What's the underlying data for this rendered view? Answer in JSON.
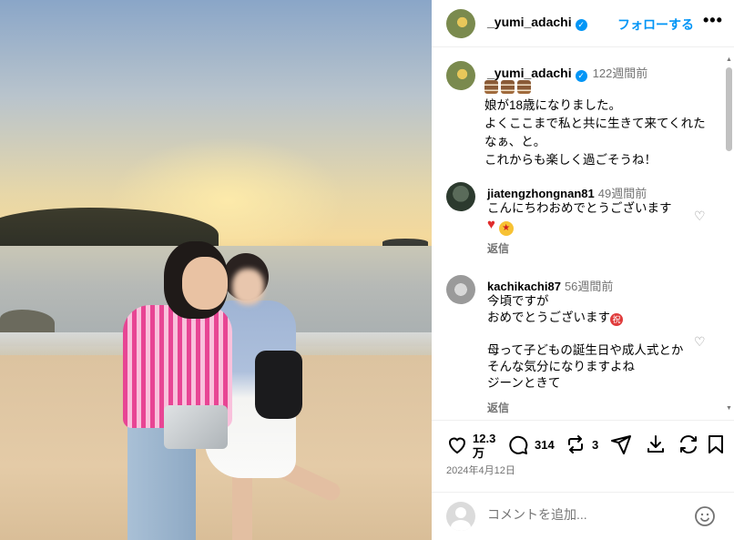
{
  "post": {
    "username": "_yumi_adachi",
    "follow_label": "フォローする",
    "more_label": "•••"
  },
  "caption": {
    "username": "_yumi_adachi",
    "time": "122週間前",
    "text": "娘が18歳になりました。\nよくここまで私と共に生きて来てくれたなぁ、と。\nこれからも楽しく過ごそうね！"
  },
  "comments": [
    {
      "username": "jiatengzhongnan81",
      "time": "49週間前",
      "text": "こんにちわおめでとうございます",
      "reply_label": "返信"
    },
    {
      "username": "kachikachi87",
      "time": "56週間前",
      "text": "今頃ですが\nおめでとうございます",
      "text2": "母って子どもの誕生日や成人式とかそんな気分になりますよね\nジーンときて",
      "reply_label": "返信"
    }
  ],
  "actions": {
    "likes": "12.3",
    "likes_unit": "万",
    "comments": "314",
    "reposts": "3",
    "date": "2024年4月12日"
  },
  "add_comment": {
    "placeholder": "コメントを追加..."
  },
  "colors": {
    "accent": "#0095f6",
    "verified": "#0095f6"
  }
}
